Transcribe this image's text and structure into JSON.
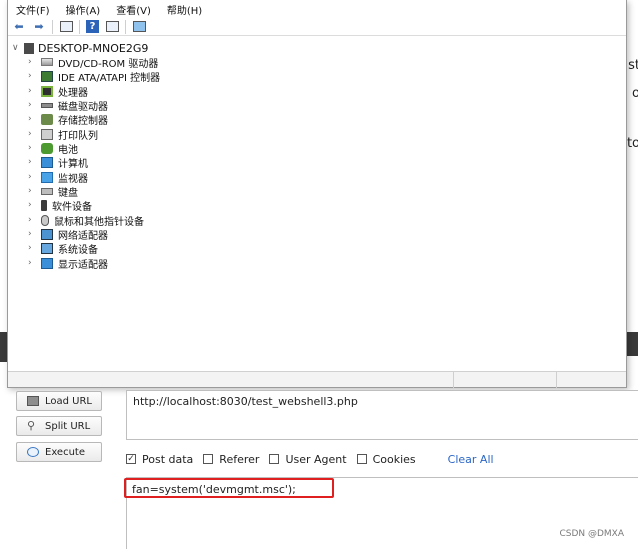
{
  "window": {
    "menu": [
      "文件(F)",
      "操作(A)",
      "查看(V)",
      "帮助(H)"
    ],
    "toolbar_icons": [
      "back-arrow-icon",
      "forward-arrow-icon",
      "properties-icon",
      "help-icon",
      "details-icon",
      "computer-scan-icon"
    ],
    "root_label": "DESKTOP-MNOE2G9",
    "devices": [
      {
        "label": "DVD/CD-ROM 驱动器",
        "icon": "dvd-drive-icon"
      },
      {
        "label": "IDE ATA/ATAPI 控制器",
        "icon": "ide-controller-icon"
      },
      {
        "label": "处理器",
        "icon": "processor-icon"
      },
      {
        "label": "磁盘驱动器",
        "icon": "disk-drive-icon"
      },
      {
        "label": "存储控制器",
        "icon": "storage-controller-icon"
      },
      {
        "label": "打印队列",
        "icon": "printer-icon"
      },
      {
        "label": "电池",
        "icon": "battery-icon"
      },
      {
        "label": "计算机",
        "icon": "computer-icon"
      },
      {
        "label": "监视器",
        "icon": "monitor-icon"
      },
      {
        "label": "键盘",
        "icon": "keyboard-icon"
      },
      {
        "label": "软件设备",
        "icon": "software-device-icon"
      },
      {
        "label": "鼠标和其他指针设备",
        "icon": "mouse-icon"
      },
      {
        "label": "网络适配器",
        "icon": "network-adapter-icon"
      },
      {
        "label": "系统设备",
        "icon": "system-device-icon"
      },
      {
        "label": "显示适配器",
        "icon": "display-adapter-icon"
      }
    ]
  },
  "background_text": [
    "st",
    "o",
    "to"
  ],
  "hackbar": {
    "load_url": "Load URL",
    "split_url": "Split URL",
    "execute": "Execute",
    "url_value": "http://localhost:8030/test_webshell3.php",
    "options": {
      "post_data": "Post data",
      "referer": "Referer",
      "user_agent": "User Agent",
      "cookies": "Cookies",
      "clear_all": "Clear All"
    },
    "post_value": "fan=system('devmgmt.msc');"
  },
  "watermark": "CSDN @DMXA",
  "colors": {
    "highlight_frame": "#e02020",
    "link": "#2a66c7"
  }
}
